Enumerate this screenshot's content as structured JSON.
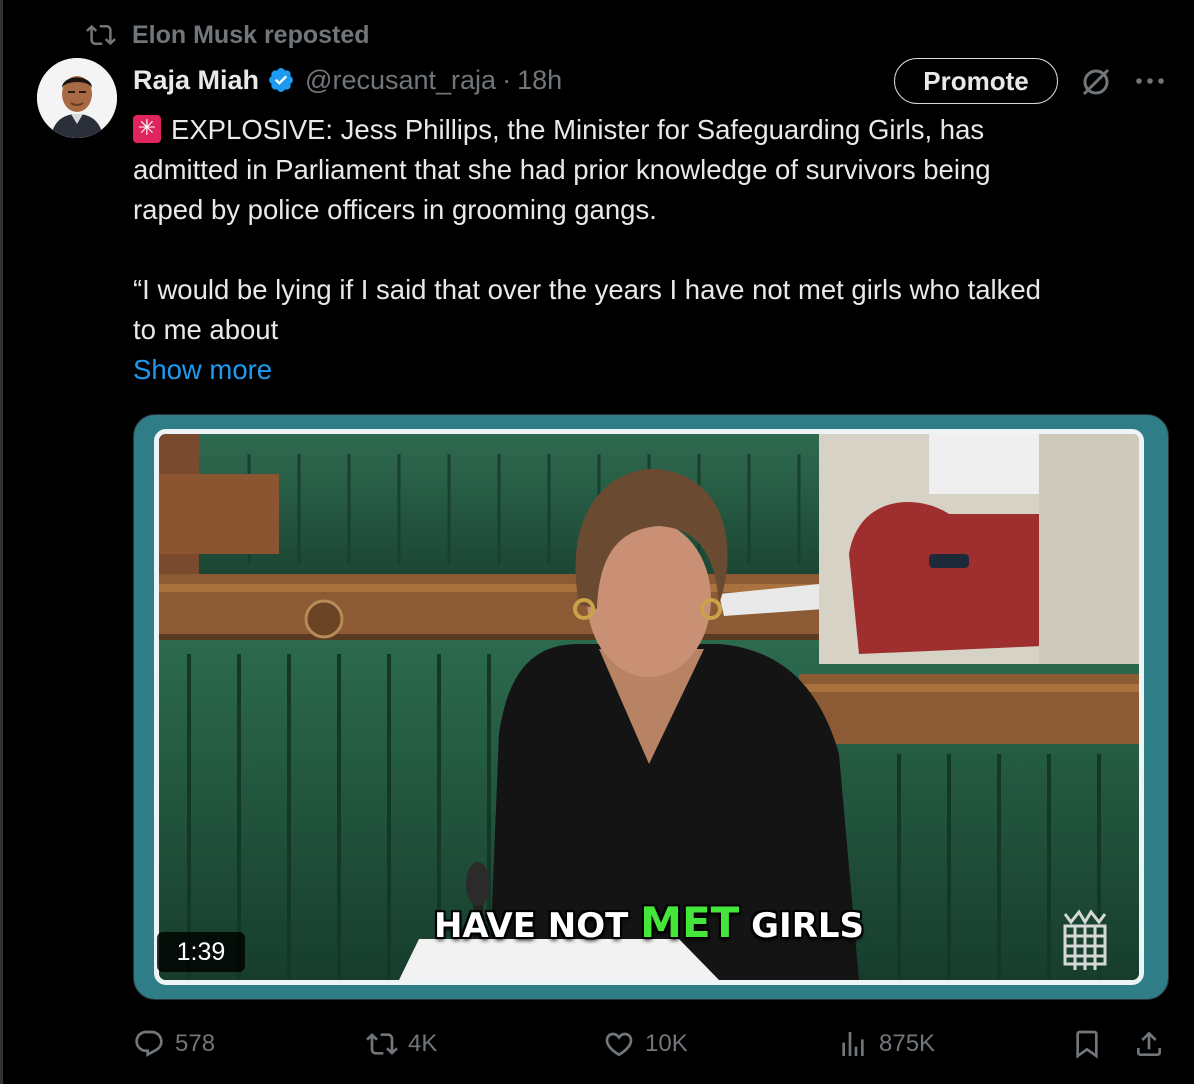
{
  "repost": {
    "icon": "repost-icon",
    "label": "Elon Musk reposted"
  },
  "author": {
    "name": "Raja Miah",
    "verified": true,
    "handle": "@recusant_raja",
    "separator": "·",
    "time": "18h"
  },
  "toolbar": {
    "promote_label": "Promote"
  },
  "tweet": {
    "text": "EXPLOSIVE: Jess Phillips, the Minister for Safeguarding Girls, has\nadmitted in Parliament that she had prior knowledge of survivors being\nraped by police officers in grooming gangs.\n\n“I would be lying if I said that over the years I have not met girls who talked\nto me about",
    "show_more": "Show more"
  },
  "media": {
    "caption_pre": "HAVE NOT ",
    "caption_highlight": "MET",
    "caption_post": " GIRLS",
    "duration": "1:39",
    "frame_color": "#2e7d87"
  },
  "actions": {
    "replies": "578",
    "reposts": "4K",
    "likes": "10K",
    "views": "875K"
  },
  "colors": {
    "background": "#000000",
    "text": "#e7e9ea",
    "muted": "#71767b",
    "link": "#1d9bf0",
    "verified": "#1d9bf0"
  }
}
